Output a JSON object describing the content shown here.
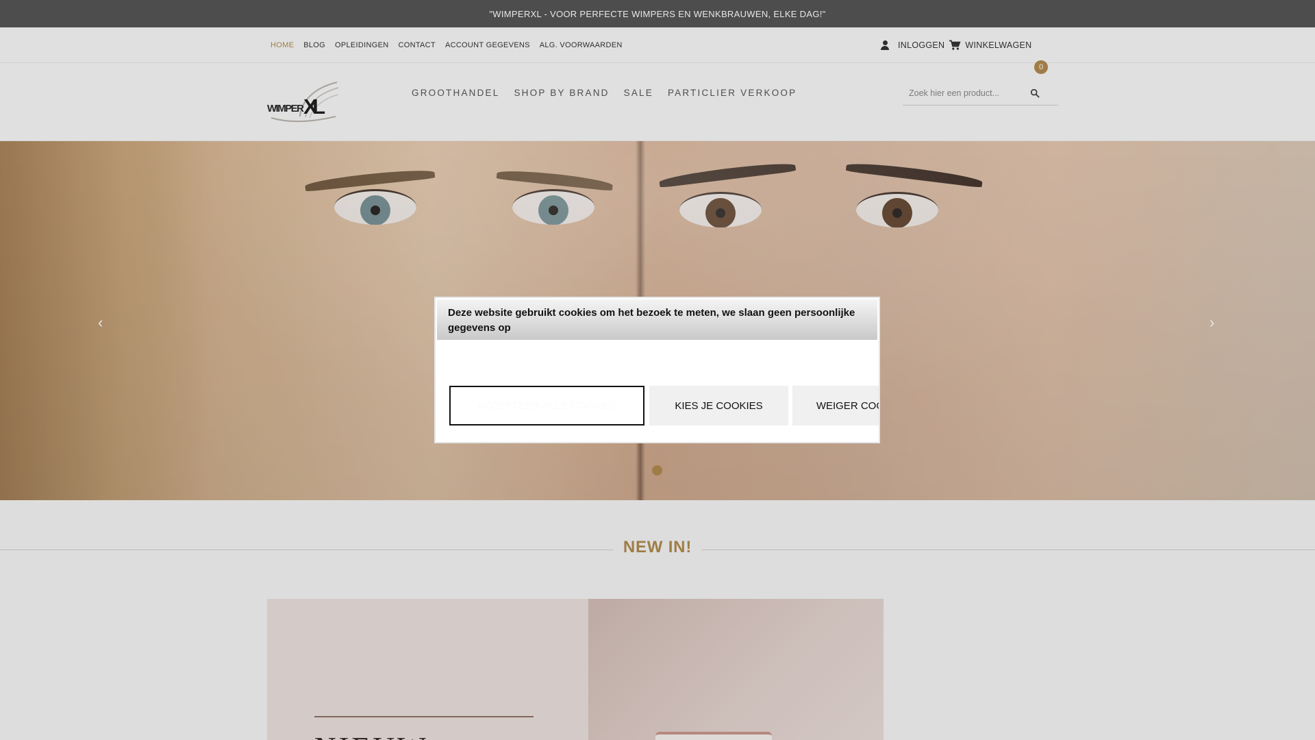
{
  "announcement": "\"WIMPERXL - VOOR PERFECTE WIMPERS EN WENKBRAUWEN, ELKE DAG!\"",
  "topnav": {
    "links": [
      "HOME",
      "BLOG",
      "OPLEIDINGEN",
      "CONTACT",
      "ACCOUNT GEGEVENS",
      "ALG. VOORWAARDEN"
    ],
    "active": "HOME",
    "login_label": "INLOGGEN",
    "cart_label": "WINKELWAGEN",
    "cart_count": "0"
  },
  "logo": {
    "text_part1": "WIMPER",
    "text_part2": "XL"
  },
  "mainnav": {
    "items": [
      "GROOTHANDEL",
      "SHOP BY BRAND",
      "SALE",
      "PARTICLIER VERKOOP"
    ]
  },
  "search": {
    "placeholder": "Zoek hier een product..."
  },
  "hero": {
    "prev_arrow": "‹",
    "next_arrow": "›",
    "slide_count": 1,
    "active_slide": 1
  },
  "section": {
    "title": "NEW IN!"
  },
  "promo": {
    "partial_text": "NIEUW"
  },
  "cookie": {
    "message": "Deze website gebruikt cookies om het bezoek te meten, we slaan geen persoonlijke gegevens op",
    "accept_label": "ACCEPTEER ALLE COOKIES",
    "choose_label": "KIES JE COOKIES",
    "reject_label": "WEIGER COOKIES"
  },
  "colors": {
    "accent": "#b08a4e",
    "announce_bg": "#555555",
    "text": "#333333"
  },
  "icons": [
    "user-icon",
    "cart-icon",
    "search-icon",
    "chevron-left-icon",
    "chevron-right-icon"
  ]
}
